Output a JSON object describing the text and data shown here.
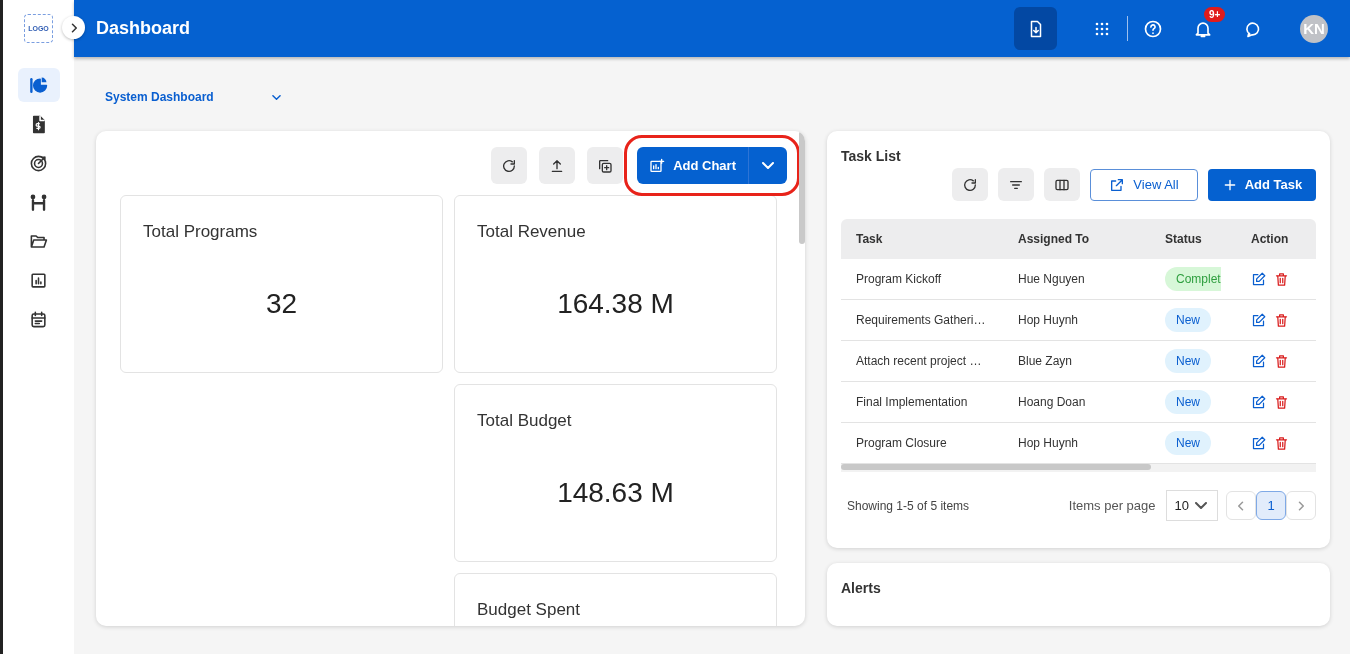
{
  "sidebar": {
    "logo": "LOGO",
    "items": [
      {
        "selected": true
      },
      {
        "selected": false
      },
      {
        "selected": false
      },
      {
        "selected": false
      },
      {
        "selected": false
      },
      {
        "selected": false
      },
      {
        "selected": false
      }
    ]
  },
  "header": {
    "title": "Dashboard",
    "notification_badge": "9+",
    "avatar": "KN"
  },
  "dashboard_select": {
    "value": "System Dashboard"
  },
  "toolbar": {
    "add_chart": {
      "label": "Add Chart",
      "highlighted": true
    }
  },
  "stat_cards": [
    {
      "title": "Total Programs",
      "value": "32"
    },
    {
      "title": "Total Revenue",
      "value": "164.38 M"
    },
    {
      "title": "Total Budget",
      "value": "148.63 M"
    },
    {
      "title": "Budget Spent"
    }
  ],
  "task_list": {
    "title": "Task List",
    "view_all": "View All",
    "add_task": "Add Task",
    "columns": [
      "Task",
      "Assigned To",
      "Status",
      "Action"
    ],
    "rows": [
      {
        "task": "Program Kickoff",
        "assigned_to": "Hue Nguyen",
        "status": "Complet",
        "kind": "completed"
      },
      {
        "task": "Requirements Gatheri…",
        "assigned_to": "Hop Huynh",
        "status": "New",
        "kind": "new"
      },
      {
        "task": "Attach recent project …",
        "assigned_to": "Blue Zayn",
        "status": "New",
        "kind": "new"
      },
      {
        "task": "Final Implementation",
        "assigned_to": "Hoang Doan",
        "status": "New",
        "kind": "new"
      },
      {
        "task": "Program Closure",
        "assigned_to": "Hop Huynh",
        "status": "New",
        "kind": "new"
      }
    ],
    "summary": "Showing 1-5 of 5 items",
    "per_page_label": "Items per page",
    "per_page": "10",
    "pages": [
      {
        "label": "1",
        "selected": true
      }
    ]
  },
  "alerts": {
    "title": "Alerts"
  }
}
